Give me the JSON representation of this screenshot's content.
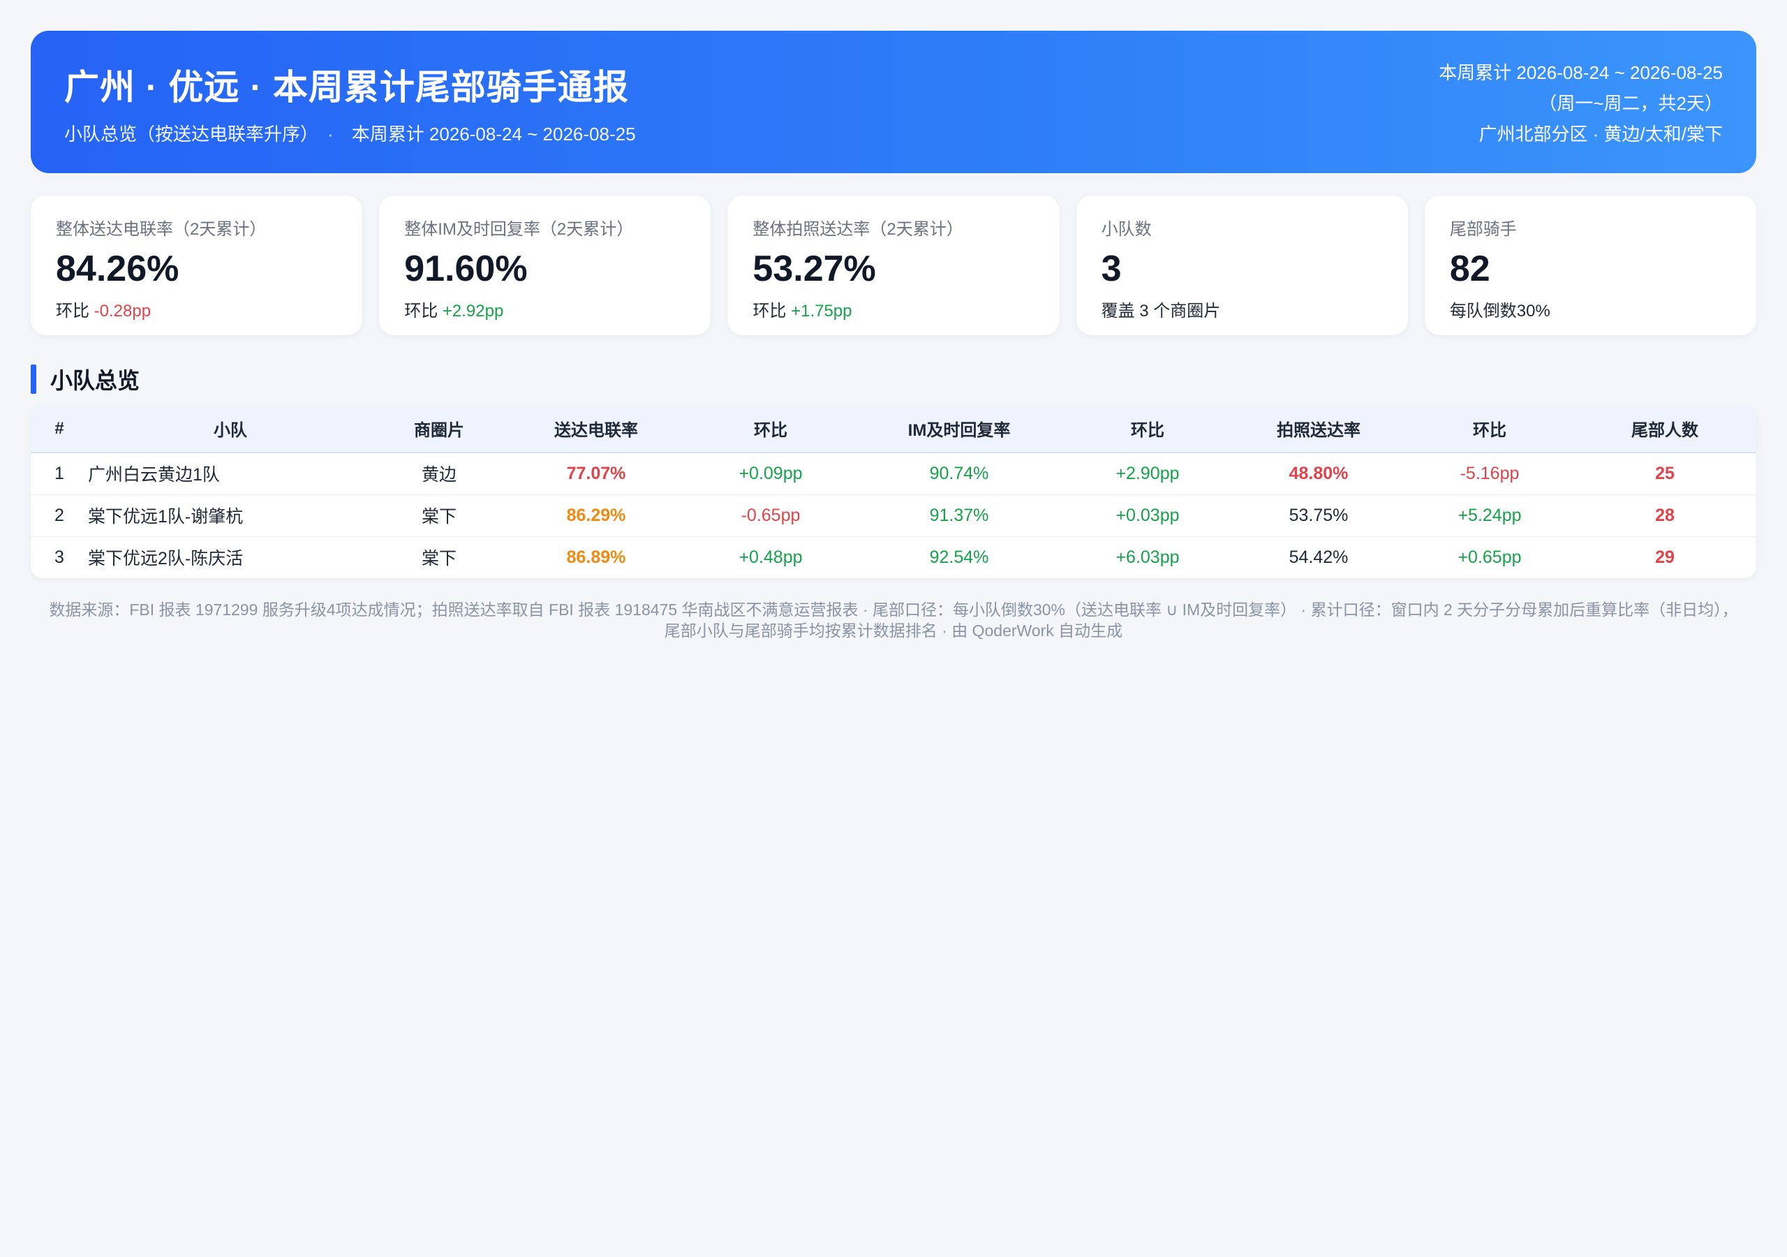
{
  "header": {
    "title": "广州 · 优远 · 本周累计尾部骑手通报",
    "subtitle_left": "小队总览（按送达电联率升序）",
    "subtitle_sep": "·",
    "subtitle_right": "本周累计 2026-08-24 ~ 2026-08-25",
    "right_line1": "本周累计 2026-08-24 ~ 2026-08-25",
    "right_line2": "（周一~周二，共2天）",
    "right_line3": "广州北部分区 · 黄边/太和/棠下"
  },
  "cards": [
    {
      "label": "整体送达电联率（2天累计）",
      "value": "84.26%",
      "note_prefix": "环比 ",
      "note_value": "-0.28pp",
      "trend": "neg"
    },
    {
      "label": "整体IM及时回复率（2天累计）",
      "value": "91.60%",
      "note_prefix": "环比 ",
      "note_value": "+2.92pp",
      "trend": "pos"
    },
    {
      "label": "整体拍照送达率（2天累计）",
      "value": "53.27%",
      "note_prefix": "环比 ",
      "note_value": "+1.75pp",
      "trend": "pos"
    },
    {
      "label": "小队数",
      "value": "3",
      "note_prefix": "覆盖 3 个商圈片",
      "note_value": "",
      "trend": ""
    },
    {
      "label": "尾部骑手",
      "value": "82",
      "note_prefix": "每队倒数30%",
      "note_value": "",
      "trend": ""
    }
  ],
  "section": {
    "title": "小队总览"
  },
  "table": {
    "headers": [
      "#",
      "小队",
      "商圈片",
      "送达电联率",
      "环比",
      "IM及时回复率",
      "环比",
      "拍照送达率",
      "环比",
      "尾部人数"
    ],
    "rows": [
      [
        "1",
        "广州白云黄边1队",
        "黄边",
        "77.07%",
        "+0.09pp",
        "90.74%",
        "+2.90pp",
        "48.80%",
        "-5.16pp",
        "25"
      ],
      [
        "2",
        "棠下优远1队-谢肇杭",
        "棠下",
        "86.29%",
        "-0.65pp",
        "91.37%",
        "+0.03pp",
        "53.75%",
        "+5.24pp",
        "28"
      ],
      [
        "3",
        "棠下优远2队-陈庆活",
        "棠下",
        "86.89%",
        "+0.48pp",
        "92.54%",
        "+6.03pp",
        "54.42%",
        "+0.65pp",
        "29"
      ]
    ]
  },
  "footer": {
    "line1": "数据来源：FBI 报表 1971299 服务升级4项达成情况；拍照送达率取自 FBI 报表 1918475 华南战区不满意运营报表 · 尾部口径：每小队倒数30%（送达电联率 ∪ IM及时回复率）   ·   累计口径：窗口内 2 天分子分母累加后重算比率（非日均），",
    "line2": "尾部小队与尾部骑手均按累计数据排名 · 由 QoderWork 自动生成"
  },
  "colors": {
    "accent": "#2563f5",
    "negative": "#e0444a",
    "positive": "#16a34a",
    "warning": "#ef8a12"
  }
}
